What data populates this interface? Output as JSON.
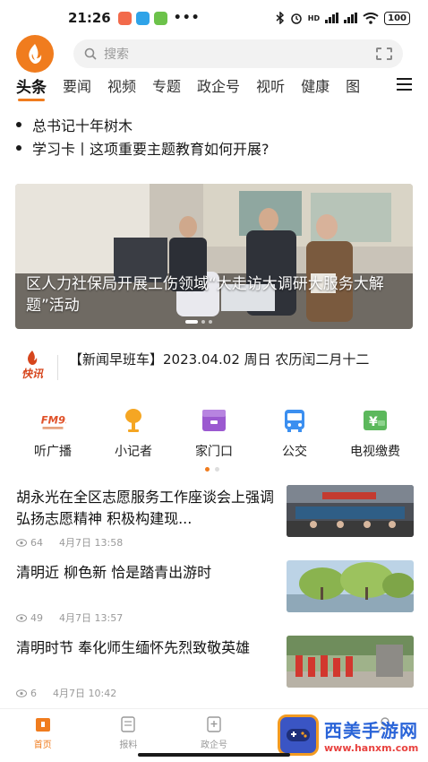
{
  "status": {
    "time": "21:26",
    "dots": "•••",
    "network": "HD",
    "battery": "100"
  },
  "search": {
    "placeholder": "搜索"
  },
  "tabs": [
    "头条",
    "要闻",
    "视频",
    "专题",
    "政企号",
    "视听",
    "健康",
    "图"
  ],
  "headlines": [
    "总书记十年树木",
    "学习卡丨这项重要主题教育如何开展?"
  ],
  "banner": {
    "title": "区人力社保局开展工伤领域“大走访大调研大服务大解题”活动"
  },
  "flash": {
    "logo": "快讯",
    "text": "【新闻早班车】2023.04.02 周日 农历闰二月十二"
  },
  "quick": [
    {
      "label": "听广播",
      "icon": "radio-logo-icon",
      "logo_text": "FM99"
    },
    {
      "label": "小记者",
      "icon": "microphone-icon"
    },
    {
      "label": "家门口",
      "icon": "shop-icon"
    },
    {
      "label": "公交",
      "icon": "bus-icon"
    },
    {
      "label": "电视缴费",
      "icon": "payment-icon"
    }
  ],
  "news": [
    {
      "title": "胡永光在全区志愿服务工作座谈会上强调 弘扬志愿精神 积极构建现...",
      "views": "64",
      "date": "4月7日 13:58"
    },
    {
      "title": "清明近 柳色新 恰是踏青出游时",
      "views": "49",
      "date": "4月7日 13:57"
    },
    {
      "title": "清明时节 奉化师生缅怀先烈致敬英雄",
      "views": "6",
      "date": "4月7日 10:42"
    }
  ],
  "bottom_nav": [
    "首页",
    "报料",
    "政企号",
    "",
    ""
  ],
  "watermark": {
    "title": "西美手游网",
    "url": "www.hanxm.com"
  },
  "colors": {
    "accent": "#f07c1e",
    "flash_red": "#d6451c"
  }
}
